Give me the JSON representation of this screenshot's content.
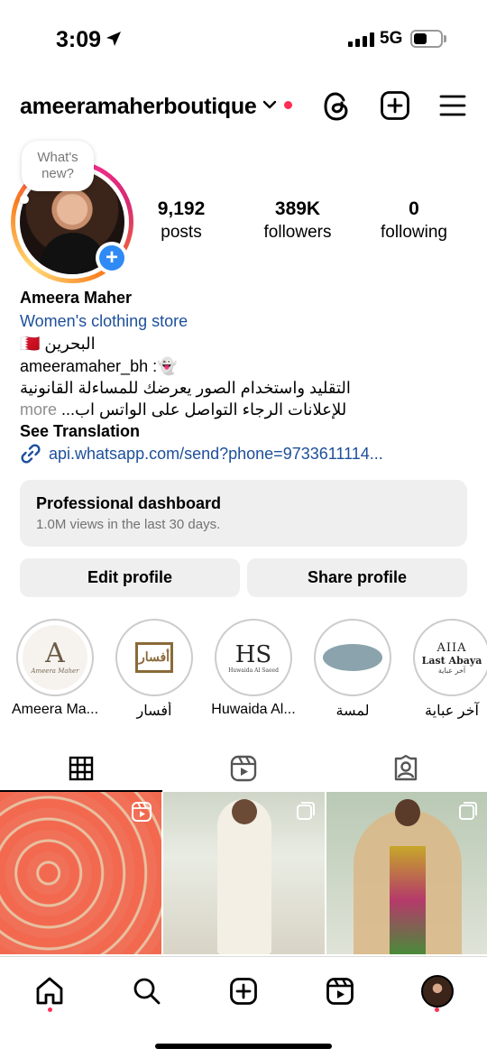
{
  "status_bar": {
    "time": "3:09",
    "network": "5G"
  },
  "header": {
    "username": "ameeramaherboutique"
  },
  "story_bubble": {
    "line1": "What's",
    "line2": "new?"
  },
  "stats": [
    {
      "value": "9,192",
      "label": "posts"
    },
    {
      "value": "389K",
      "label": "followers"
    },
    {
      "value": "0",
      "label": "following"
    }
  ],
  "bio": {
    "name": "Ameera Maher",
    "category": "Women's clothing store",
    "location": "البحرين 🇧🇭",
    "snapchat": "ameeramaher_bh :👻",
    "line1": "التقليد واستخدام الصور يعرضك للمساءلة القانونية",
    "line2": "للإعلانات الرجاء التواصل على الواتس اب...",
    "more": "more",
    "see_translation": "See Translation",
    "link": "api.whatsapp.com/send?phone=9733611114..."
  },
  "dashboard": {
    "title": "Professional dashboard",
    "subtitle": "1.0M views in the last 30 days."
  },
  "buttons": {
    "edit": "Edit profile",
    "share": "Share profile"
  },
  "highlights": [
    {
      "label": "Ameera Ma...",
      "logo": "A"
    },
    {
      "label": "أفسار",
      "logo": "أفسار"
    },
    {
      "label": "Huwaida Al...",
      "logo": "HS"
    },
    {
      "label": "لمسة",
      "logo": ""
    },
    {
      "label": "آخر عباية",
      "logo": "Last Abaya"
    }
  ],
  "highlight_logo_text": {
    "ameera_sub": "Ameera Maher",
    "huwaida_sub": "Huwaida Al Saeed",
    "last_abaya_top": "AIIA",
    "last_abaya_ar": "آخر عباية"
  },
  "tabs": [
    "grid-icon",
    "reels-icon",
    "tagged-icon"
  ],
  "accent_colors": {
    "link": "#1d4f9b",
    "badge": "#2f8af5",
    "notification": "#ff2d55"
  }
}
